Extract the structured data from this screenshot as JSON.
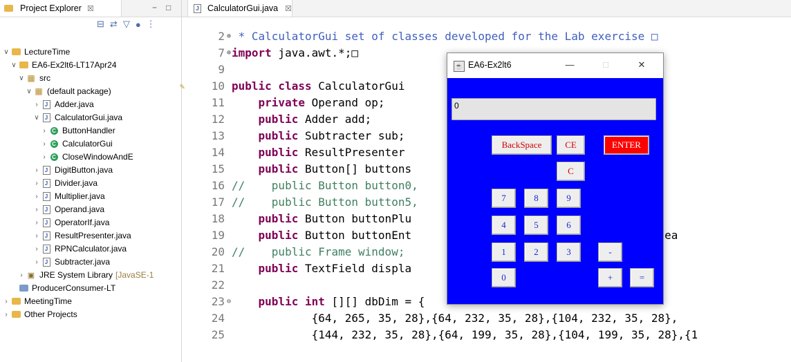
{
  "explorer": {
    "tab_label": "Project Explorer",
    "tab_close": "☒",
    "minimize": "−",
    "maximize": "□",
    "toolbar": [
      "⊟",
      "⇄",
      "▽",
      "●",
      "⋮"
    ],
    "tree": [
      {
        "label": "LectureTime",
        "icon": "project-folder-icon",
        "twisty": "∨",
        "depth": 0
      },
      {
        "label": "EA6-Ex2lt6-LT17Apr24",
        "icon": "java-project-icon",
        "twisty": "∨",
        "depth": 1
      },
      {
        "label": "src",
        "icon": "source-folder-icon",
        "twisty": "∨",
        "depth": 2
      },
      {
        "label": "(default package)",
        "icon": "package-icon",
        "twisty": "∨",
        "depth": 3
      },
      {
        "label": "Adder.java",
        "icon": "java-file-icon",
        "twisty": "›",
        "depth": 4
      },
      {
        "label": "CalculatorGui.java",
        "icon": "java-file-icon",
        "twisty": "∨",
        "depth": 4
      },
      {
        "label": "ButtonHandler",
        "icon": "class-icon",
        "twisty": "›",
        "depth": 5
      },
      {
        "label": "CalculatorGui",
        "icon": "class-icon",
        "twisty": "›",
        "depth": 5
      },
      {
        "label": "CloseWindowAndE",
        "icon": "class-icon",
        "twisty": "›",
        "depth": 5
      },
      {
        "label": "DigitButton.java",
        "icon": "java-file-icon",
        "twisty": "›",
        "depth": 4
      },
      {
        "label": "Divider.java",
        "icon": "java-file-icon",
        "twisty": "›",
        "depth": 4
      },
      {
        "label": "Multiplier.java",
        "icon": "java-file-icon",
        "twisty": "›",
        "depth": 4
      },
      {
        "label": "Operand.java",
        "icon": "java-file-icon",
        "twisty": "›",
        "depth": 4
      },
      {
        "label": "OperatorIf.java",
        "icon": "java-interface-icon",
        "twisty": "›",
        "depth": 4
      },
      {
        "label": "ResultPresenter.java",
        "icon": "java-file-icon",
        "twisty": "›",
        "depth": 4
      },
      {
        "label": "RPNCalculator.java",
        "icon": "java-file-icon",
        "twisty": "›",
        "depth": 4
      },
      {
        "label": "Subtracter.java",
        "icon": "java-file-icon",
        "twisty": "›",
        "depth": 4
      },
      {
        "label": "JRE System Library",
        "suffix": "[JavaSE-1",
        "icon": "library-icon",
        "twisty": "›",
        "depth": 2
      },
      {
        "label": "ProducerConsumer-LT",
        "icon": "closed-project-icon",
        "twisty": "",
        "depth": 1
      },
      {
        "label": "MeetingTime",
        "icon": "project-folder-icon",
        "twisty": "›",
        "depth": 0
      },
      {
        "label": "Other Projects",
        "icon": "project-folder-icon",
        "twisty": "›",
        "depth": 0
      }
    ]
  },
  "editor": {
    "tab_label": "CalculatorGui.java",
    "tab_close": "☒",
    "lines": [
      {
        "num": "2",
        "fold": "⊕",
        "parts": [
          {
            "t": " * CalculatorGui set of classes developed for the Lab exercise □",
            "c": "cm"
          }
        ]
      },
      {
        "num": "7",
        "fold": "⊕",
        "parts": [
          {
            "t": "import",
            "c": "kw"
          },
          {
            "t": " java.awt.*;□",
            "c": ""
          }
        ]
      },
      {
        "num": "9",
        "fold": "",
        "parts": []
      },
      {
        "num": "10",
        "fold": "",
        "marker": true,
        "parts": [
          {
            "t": "public class",
            "c": "kw"
          },
          {
            "t": " CalculatorGui",
            "c": ""
          }
        ]
      },
      {
        "num": "11",
        "fold": "",
        "parts": [
          {
            "t": "    ",
            "c": ""
          },
          {
            "t": "private",
            "c": "kw"
          },
          {
            "t": " Operand op;",
            "c": ""
          }
        ]
      },
      {
        "num": "12",
        "fold": "",
        "parts": [
          {
            "t": "    ",
            "c": ""
          },
          {
            "t": "public",
            "c": "kw"
          },
          {
            "t": " Adder add;",
            "c": ""
          }
        ]
      },
      {
        "num": "13",
        "fold": "",
        "parts": [
          {
            "t": "    ",
            "c": ""
          },
          {
            "t": "public",
            "c": "kw"
          },
          {
            "t": " Subtracter sub;",
            "c": ""
          }
        ]
      },
      {
        "num": "14",
        "fold": "",
        "parts": [
          {
            "t": "    ",
            "c": ""
          },
          {
            "t": "public",
            "c": "kw"
          },
          {
            "t": " ResultPresenter",
            "c": ""
          }
        ]
      },
      {
        "num": "15",
        "fold": "",
        "parts": [
          {
            "t": "    ",
            "c": ""
          },
          {
            "t": "public",
            "c": "kw"
          },
          {
            "t": " Button[] buttons",
            "c": ""
          }
        ]
      },
      {
        "num": "16",
        "fold": "",
        "parts": [
          {
            "t": "//    public Button button0,                          button4;",
            "c": "cm2"
          }
        ]
      },
      {
        "num": "17",
        "fold": "",
        "parts": [
          {
            "t": "//    public Button button5,                          button9;",
            "c": "cm2"
          }
        ]
      },
      {
        "num": "18",
        "fold": "",
        "parts": [
          {
            "t": "    ",
            "c": ""
          },
          {
            "t": "public",
            "c": "kw"
          },
          {
            "t": " Button buttonPlu                        ltPresenter;",
            "c": ""
          }
        ]
      },
      {
        "num": "19",
        "fold": "",
        "parts": [
          {
            "t": "    ",
            "c": ""
          },
          {
            "t": "public",
            "c": "kw"
          },
          {
            "t": " Button buttonEnt                       nClear,buttonClea",
            "c": ""
          }
        ]
      },
      {
        "num": "20",
        "fold": "",
        "parts": [
          {
            "t": "//    public Frame window;",
            "c": "cm2"
          }
        ]
      },
      {
        "num": "21",
        "fold": "",
        "parts": [
          {
            "t": "    ",
            "c": ""
          },
          {
            "t": "public",
            "c": "kw"
          },
          {
            "t": " TextField displa",
            "c": ""
          }
        ]
      },
      {
        "num": "22",
        "fold": "",
        "parts": []
      },
      {
        "num": "23",
        "fold": "⊖",
        "parts": [
          {
            "t": "    ",
            "c": ""
          },
          {
            "t": "public int",
            "c": "kw"
          },
          {
            "t": " [][] dbDim = {",
            "c": ""
          }
        ]
      },
      {
        "num": "24",
        "fold": "",
        "parts": [
          {
            "t": "            {64, 265, 35, 28},{64, 232, 35, 28},{104, 232, 35, 28},",
            "c": ""
          }
        ]
      },
      {
        "num": "25",
        "fold": "",
        "parts": [
          {
            "t": "            {144, 232, 35, 28},{64, 199, 35, 28},{104, 199, 35, 28},{1",
            "c": ""
          }
        ]
      }
    ]
  },
  "calc": {
    "title": "EA6-Ex2lt6",
    "minimize": "—",
    "maximize": "□",
    "close": "✕",
    "display_value": "0",
    "buttons": {
      "backspace": "BackSpace",
      "ce": "CE",
      "enter": "ENTER",
      "c": "C",
      "d7": "7",
      "d8": "8",
      "d9": "9",
      "d4": "4",
      "d5": "5",
      "d6": "6",
      "d1": "1",
      "d2": "2",
      "d3": "3",
      "minus": "-",
      "d0": "0",
      "plus": "+",
      "equals": "="
    }
  },
  "colors": {
    "calc_background": "#0000ff",
    "enter_button": "#ff0000",
    "keyword": "#7f0055",
    "javadoc": "#3f5fbf",
    "comment": "#3f7f5f"
  }
}
